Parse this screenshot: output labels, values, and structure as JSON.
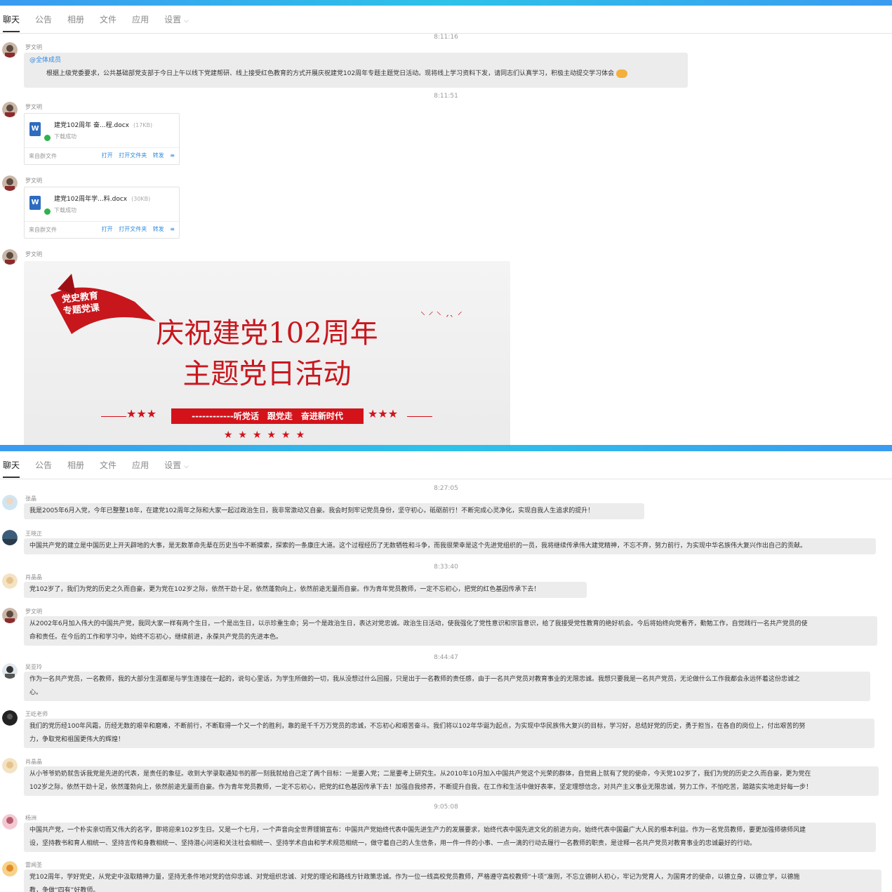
{
  "panel1": {
    "tabs": [
      {
        "label": "聊天",
        "active": true
      },
      {
        "label": "公告"
      },
      {
        "label": "相册"
      },
      {
        "label": "文件"
      },
      {
        "label": "应用"
      },
      {
        "label": "设置"
      }
    ],
    "timestamps": [
      "8:11:16",
      "8:11:51"
    ],
    "messages": [
      {
        "sender": "罗文明",
        "mention": "@全体成员",
        "text": "根据上级党委要求，公共基础部党支部于今日上午以线下党建帮研、线上接受红色教育的方式开展庆祝建党102周年专题主题党日活动。现将线上学习资料下发，请同志们认真学习，积极主动提交学习体会"
      },
      {
        "sender": "罗文明",
        "file": {
          "name": "建党102周年 奋...程.docx",
          "size": "(17KB)",
          "status": "下载成功",
          "source": "来自群文件",
          "actions": [
            "打开",
            "打开文件夹",
            "转发"
          ]
        }
      },
      {
        "sender": "罗文明",
        "file": {
          "name": "建党102周年学...料.docx",
          "size": "(30KB)",
          "status": "下载成功",
          "source": "来自群文件",
          "actions": [
            "打开",
            "打开文件夹",
            "转发"
          ]
        }
      },
      {
        "sender": "罗文明",
        "banner": {
          "ribbon_line1": "党史教育",
          "ribbon_line2": "专题党课",
          "title_line1": "庆祝建党102周年",
          "title_line2": "主题党日活动",
          "slogan": "------------听党话　跟党走　奋进新时代"
        }
      }
    ]
  },
  "panel2": {
    "tabs": [
      {
        "label": "聊天",
        "active": true
      },
      {
        "label": "公告"
      },
      {
        "label": "相册"
      },
      {
        "label": "文件"
      },
      {
        "label": "应用"
      },
      {
        "label": "设置"
      }
    ],
    "timestamps": [
      "8:27:05",
      "8:33:40",
      "8:44:47",
      "9:05:08"
    ],
    "messages": [
      {
        "sender": "张晶",
        "lines": [
          "我是2005年6月入党，今年已整整18年，在建党102周年之际和大家一起过政治生日，我非常激动又自豪。我会时刻牢记党员身份，坚守初心，砥砺前行！不断完成心灵净化，实现自我人生追求的提升！"
        ]
      },
      {
        "sender": "王晓正",
        "lines": [
          "中国共产党的建立是中国历史上开天辟地的大事，是无数革命先辈在历史当中不断摸索，探索的一条康庄大道。这个过程经历了无数牺牲和斗争，而我很荣幸是这个先进党组织的一员，我将继续传承伟大建党精神，不忘不弃，努力前行，为实现中华名族伟大复兴作出自己的贡献。"
        ]
      },
      {
        "sender": "肖晶晶",
        "lines": [
          "党102岁了，我们为党的历史之久而自豪，更为党在102岁之际，依然干劲十足，依然蓬勃向上，依然前途无量而自豪。作为青年党员教师，一定不忘初心，把党的红色基因传承下去！"
        ]
      },
      {
        "sender": "罗文明",
        "lines": [
          "从2002年6月加入伟大的中国共产党，我同大家一样有两个生日，一个是出生日，以示珍重生命；另一个是政治生日，表达对党忠诚。政治生日活动，使我强化了党性意识和宗旨意识，给了我接受党性教育的绝好机会。今后将始终向党看齐，勤勉工作，自觉践行一名共产党员的使",
          "命和责任。在今后的工作和学习中，始终不忘初心，继续前进，永葆共产党员的先进本色。"
        ]
      },
      {
        "sender": "吴亚玲",
        "lines": [
          "作为一名共产党员，一名教师，我的大部分生涯都是与学生连接在一起的，说句心里话，为学生所做的一切，我从没想过什么回报，只是出于一名教师的责任感，由于一名共产党员对教育事业的无限忠诚。我想只要我是一名共产党员，无论做什么工作我都会永远怀着这份忠诚之",
          "心。"
        ]
      },
      {
        "sender": "王屹老师",
        "lines": [
          "我们的党历经100年风霜，历经无数的艰辛和磨难，不断前行，不断取得一个又一个的胜利，靠的是千千万万党员的忠诚，不忘初心和艰苦奋斗。我们将以102年华诞为起点，为实现中华民族伟大复兴的目标，学习好，总结好党的历史，勇于担当，在各自的岗位上，付出艰苦的努",
          "力，争取党和祖国更伟大的辉煌！"
        ]
      },
      {
        "sender": "肖晶晶",
        "lines": [
          "从小爷爷奶奶就告诉我党是先进的代表，是责任的象征。收到大学录取通知书的那一刻我就给自己定了两个目标：一是要入党；二是要考上研究生。从2010年10月加入中国共产党这个光荣的群体，自觉肩上就有了党的使命，今天党102岁了，我们为党的历史之久而自豪，更为党在",
          "102岁之际，依然干劲十足，依然蓬勃向上，依然前途无量而自豪。作为青年党员教师，一定不忘初心，把党的红色基因传承下去！加强自我修养，不断提升自我，在工作和生活中做好表率，坚定理想信念，对共产主义事业无限忠诚，努力工作，不怕吃苦，踏踏实实地走好每一步！"
        ]
      },
      {
        "sender": "杨洲",
        "lines": [
          "中国共产党，一个朴实亲切而又伟大的名字，即将迎来102岁生日。又是一个七月，一个声音向全世界铿锵宣布：中国共产党始终代表中国先进生产力的发展要求，始终代表中国先进文化的前进方向，始终代表中国最广大人民的根本利益。作为一名党员教师，要更加强师德师风建",
          "设，坚持教书和育人相统一、坚持言传和身教相统一、坚持潜心问道和关注社会相统一、坚持学术自由和学术规范相统一，做守着自己的人生信条，用一件一件的小事、一点一滴的行动去履行一名教师的职责，是诠释一名共产党员对教育事业的忠诚最好的行动。"
        ]
      },
      {
        "sender": "雷闻圣",
        "lines": [
          "党102周年，学好党史，从党史中汲取精神力量，坚持无条件地对党的信仰忠诚、对党组织忠诚、对党的理论和路线方针政策忠诚。作为一位一线高校党员教师，严格遵守高校教师“十项”准则，不忘立德树人初心，牢记为党育人，为国育才的使命，以德立身，以德立学，以德施",
          "教，争做“四有”好教师。"
        ]
      }
    ]
  }
}
